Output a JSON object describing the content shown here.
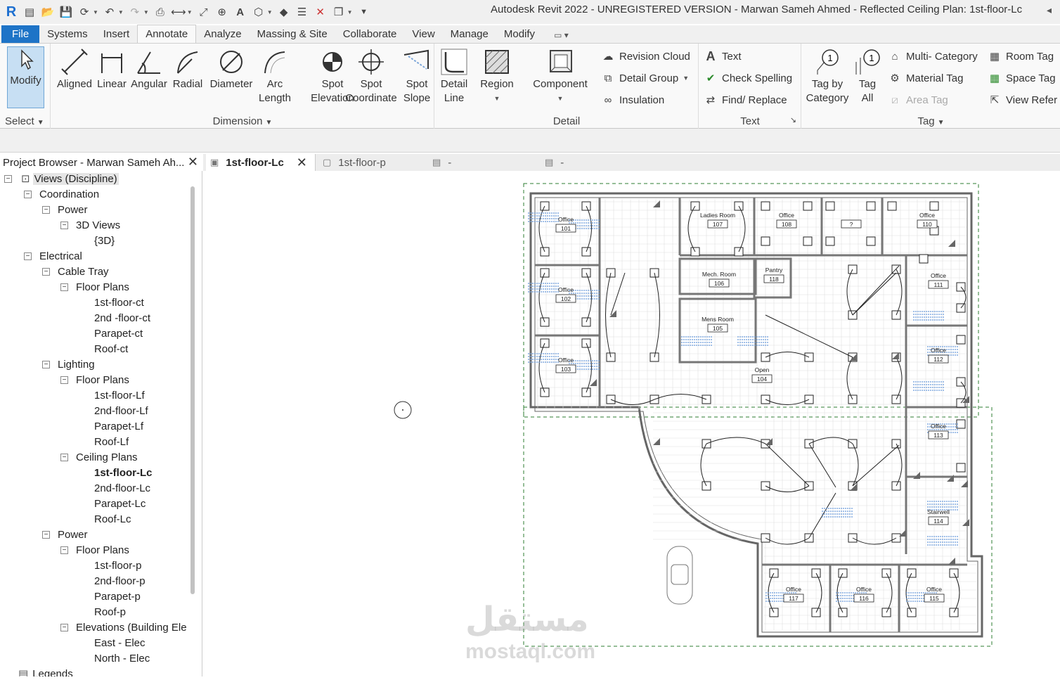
{
  "title_bar": {
    "title": "Autodesk Revit 2022 - UNREGISTERED VERSION - Marwan Sameh Ahmed - Reflected Ceiling Plan: 1st-floor-Lc"
  },
  "tabs": [
    "File",
    "Systems",
    "Insert",
    "Annotate",
    "Analyze",
    "Massing & Site",
    "Collaborate",
    "View",
    "Manage",
    "Modify"
  ],
  "active_tab": "Annotate",
  "ribbon": {
    "select": {
      "button": "Modify",
      "label": "Select"
    },
    "dimension": {
      "label": "Dimension",
      "buttons": [
        {
          "l1": "Aligned",
          "l2": ""
        },
        {
          "l1": "Linear",
          "l2": ""
        },
        {
          "l1": "Angular",
          "l2": ""
        },
        {
          "l1": "Radial",
          "l2": ""
        },
        {
          "l1": "Diameter",
          "l2": ""
        },
        {
          "l1": "Arc",
          "l2": "Length"
        },
        {
          "l1": "Spot",
          "l2": "Elevation"
        },
        {
          "l1": "Spot",
          "l2": "Coordinate"
        },
        {
          "l1": "Spot",
          "l2": "Slope"
        }
      ]
    },
    "detail": {
      "label": "Detail",
      "detail_line_1": "Detail",
      "detail_line_2": "Line",
      "region": "Region",
      "component": "Component",
      "revision_cloud": "Revision  Cloud",
      "detail_group": "Detail  Group",
      "insulation": "Insulation"
    },
    "text": {
      "label": "Text",
      "text": "Text",
      "check_spelling": "Check  Spelling",
      "find_replace": "Find/  Replace"
    },
    "tag": {
      "label": "Tag",
      "tag_by_category_1": "Tag by",
      "tag_by_category_2": "Category",
      "tag_all_1": "Tag",
      "tag_all_2": "All",
      "multi_category": "Multi- Category",
      "material_tag": "Material  Tag",
      "area_tag": "Area  Tag",
      "room_tag": "Room  Tag",
      "space_tag": "Space  Tag",
      "view_reference": "View  Refer"
    }
  },
  "project_browser": {
    "title": "Project Browser - Marwan Sameh Ah...",
    "items": [
      {
        "label": "Views (Discipline)",
        "level": 0
      },
      {
        "label": "Coordination",
        "level": 1
      },
      {
        "label": "Power",
        "level": 2
      },
      {
        "label": "3D Views",
        "level": 3
      },
      {
        "label": "{3D}",
        "level": 4
      },
      {
        "label": "Electrical",
        "level": 1
      },
      {
        "label": "Cable Tray",
        "level": 2
      },
      {
        "label": "Floor Plans",
        "level": 3
      },
      {
        "label": "1st-floor-ct",
        "level": 4
      },
      {
        "label": "2nd -floor-ct",
        "level": 4
      },
      {
        "label": "Parapet-ct",
        "level": 4
      },
      {
        "label": "Roof-ct",
        "level": 4
      },
      {
        "label": "Lighting",
        "level": 2
      },
      {
        "label": "Floor Plans",
        "level": 3
      },
      {
        "label": "1st-floor-Lf",
        "level": 4
      },
      {
        "label": "2nd-floor-Lf",
        "level": 4
      },
      {
        "label": "Parapet-Lf",
        "level": 4
      },
      {
        "label": "Roof-Lf",
        "level": 4
      },
      {
        "label": "Ceiling Plans",
        "level": 3
      },
      {
        "label": "1st-floor-Lc",
        "level": 4
      },
      {
        "label": "2nd-floor-Lc",
        "level": 4
      },
      {
        "label": "Parapet-Lc",
        "level": 4
      },
      {
        "label": "Roof-Lc",
        "level": 4
      },
      {
        "label": "Power",
        "level": 2
      },
      {
        "label": "Floor Plans",
        "level": 3
      },
      {
        "label": "1st-floor-p",
        "level": 4
      },
      {
        "label": "2nd-floor-p",
        "level": 4
      },
      {
        "label": "Parapet-p",
        "level": 4
      },
      {
        "label": "Roof-p",
        "level": 4
      },
      {
        "label": "Elevations (Building Ele",
        "level": 3
      },
      {
        "label": "East - Elec",
        "level": 4
      },
      {
        "label": "North - Elec",
        "level": 4
      },
      {
        "label": "Legends",
        "level": 0
      }
    ]
  },
  "view_tabs": [
    {
      "label": "1st-floor-Lc",
      "active": true
    },
    {
      "label": "1st-floor-p",
      "active": false
    },
    {
      "label": "-",
      "active": false
    },
    {
      "label": "-",
      "active": false
    }
  ],
  "plan": {
    "rooms": [
      {
        "name": "Office",
        "num": "101"
      },
      {
        "name": "Office",
        "num": "102"
      },
      {
        "name": "Office",
        "num": "103"
      },
      {
        "name": "Ladies Room",
        "num": "107"
      },
      {
        "name": "Office",
        "num": "108"
      },
      {
        "name": "",
        "num": "?"
      },
      {
        "name": "Office",
        "num": "110"
      },
      {
        "name": "Mech. Room",
        "num": "106"
      },
      {
        "name": "Pantry",
        "num": "118"
      },
      {
        "name": "Office",
        "num": "111"
      },
      {
        "name": "Mens Room",
        "num": "105"
      },
      {
        "name": "Open",
        "num": "104"
      },
      {
        "name": "Office",
        "num": "112"
      },
      {
        "name": "Office",
        "num": "113"
      },
      {
        "name": "Stairwell",
        "num": "114"
      },
      {
        "name": "Office",
        "num": "117"
      },
      {
        "name": "Office",
        "num": "116"
      },
      {
        "name": "Office",
        "num": "115"
      }
    ]
  },
  "watermark": {
    "ar": "مستقل",
    "en": "mostaql.com"
  }
}
